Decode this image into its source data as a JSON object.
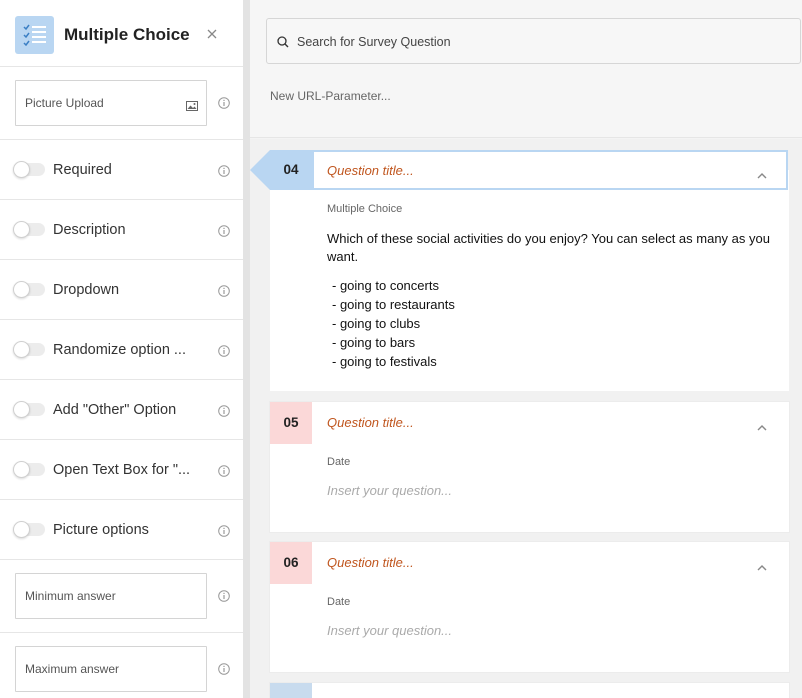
{
  "left_panel": {
    "title": "Multiple Choice",
    "picture_upload": "Picture Upload",
    "toggles": [
      {
        "label": "Required",
        "on": false
      },
      {
        "label": "Description",
        "on": false
      },
      {
        "label": "Dropdown",
        "on": false
      },
      {
        "label": "Randomize option ...",
        "on": false
      },
      {
        "label": "Add \"Other\" Option",
        "on": false
      },
      {
        "label": "Open Text Box for \"...",
        "on": false
      },
      {
        "label": "Picture options",
        "on": false
      }
    ],
    "minimum_answer": "Minimum answer",
    "maximum_answer": "Maximum answer",
    "icons": {
      "type": "checklist-icon",
      "close": "close-icon",
      "image": "image-icon",
      "info": "info-icon"
    }
  },
  "top": {
    "search_placeholder": "Search for Survey Question",
    "url_param": "New URL-Parameter..."
  },
  "questions": [
    {
      "number": "04",
      "title": "Question title...",
      "type": "Multiple Choice",
      "text": "Which of these social activities do you enjoy? You can select as many as you want.",
      "options": [
        "- going to concerts",
        "- going to restaurants",
        "- going to clubs",
        "- going to bars",
        "- going to festivals"
      ]
    },
    {
      "number": "05",
      "title": "Question title...",
      "type": "Date",
      "placeholder": "Insert your question..."
    },
    {
      "number": "06",
      "title": "Question title...",
      "type": "Date",
      "placeholder": "Insert your question..."
    }
  ],
  "colors": {
    "accent_blue": "#b9d6f2",
    "number_pink": "#fbd8d8",
    "title_orange": "#c0561f"
  }
}
